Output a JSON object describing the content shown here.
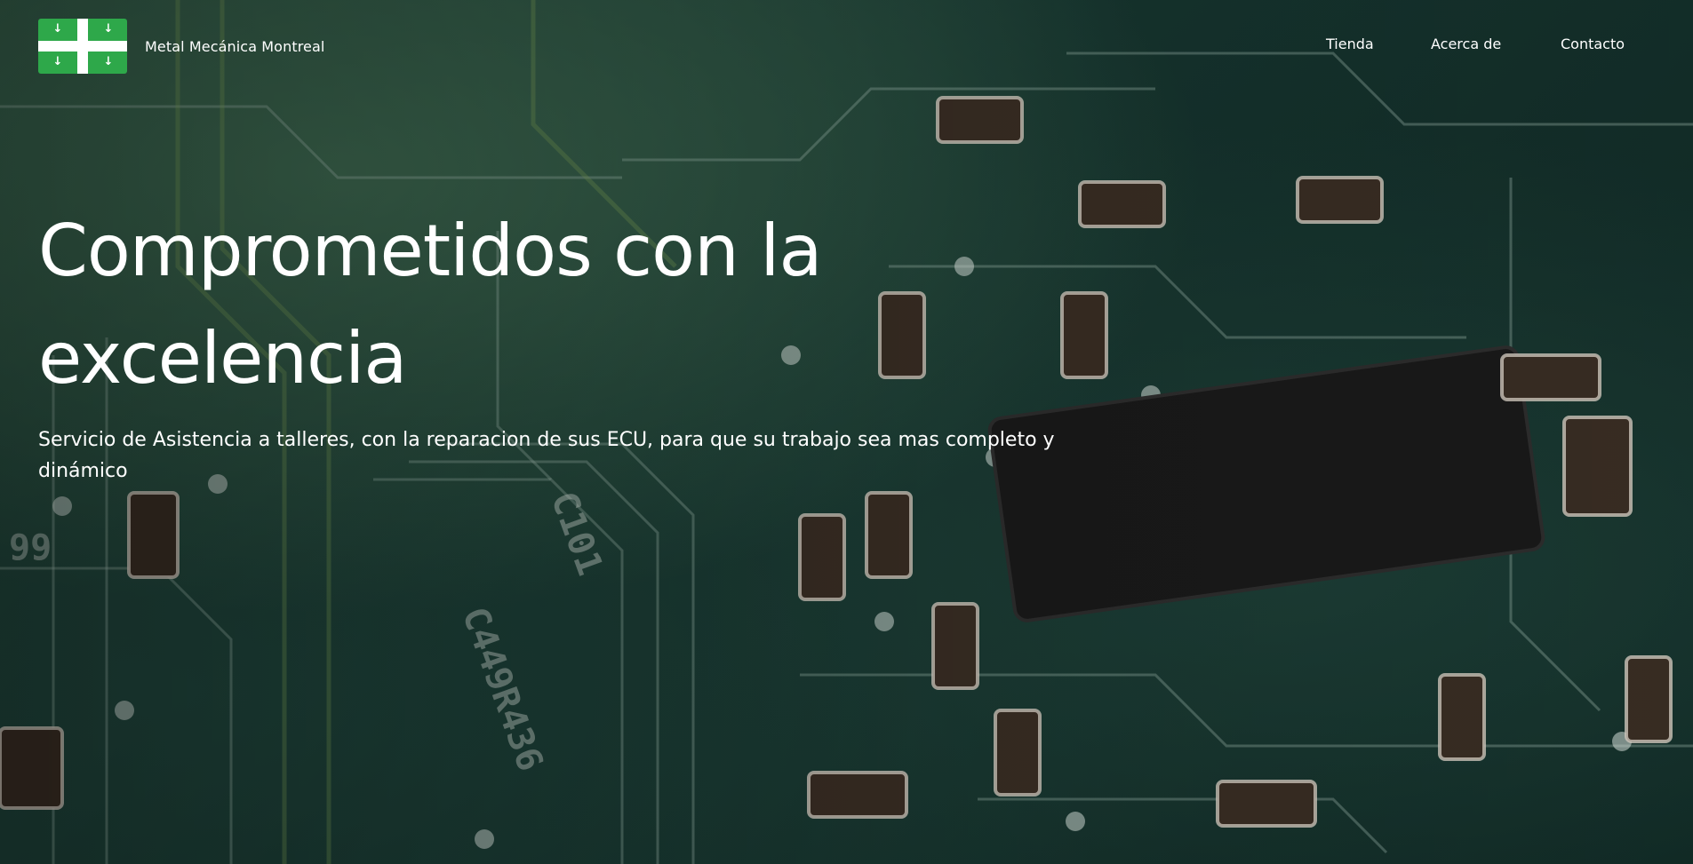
{
  "colors": {
    "brand_green": "#2ea84a",
    "text": "#ffffff",
    "background": "#16352f"
  },
  "header": {
    "brand": {
      "logo_icon": "green-flag-cross-with-arrows-logo",
      "name": "Metal Mecánica Montreal"
    },
    "nav": {
      "tienda": "Tienda",
      "acerca": "Acerca de",
      "contacto": "Contacto"
    }
  },
  "hero": {
    "background_icon": "circuit-board-image",
    "title": "Comprometidos con la excelencia",
    "subtitle": "Servicio de Asistencia a talleres, con la reparacion de sus ECU, para que su trabajo sea mas completo y dinámico"
  }
}
